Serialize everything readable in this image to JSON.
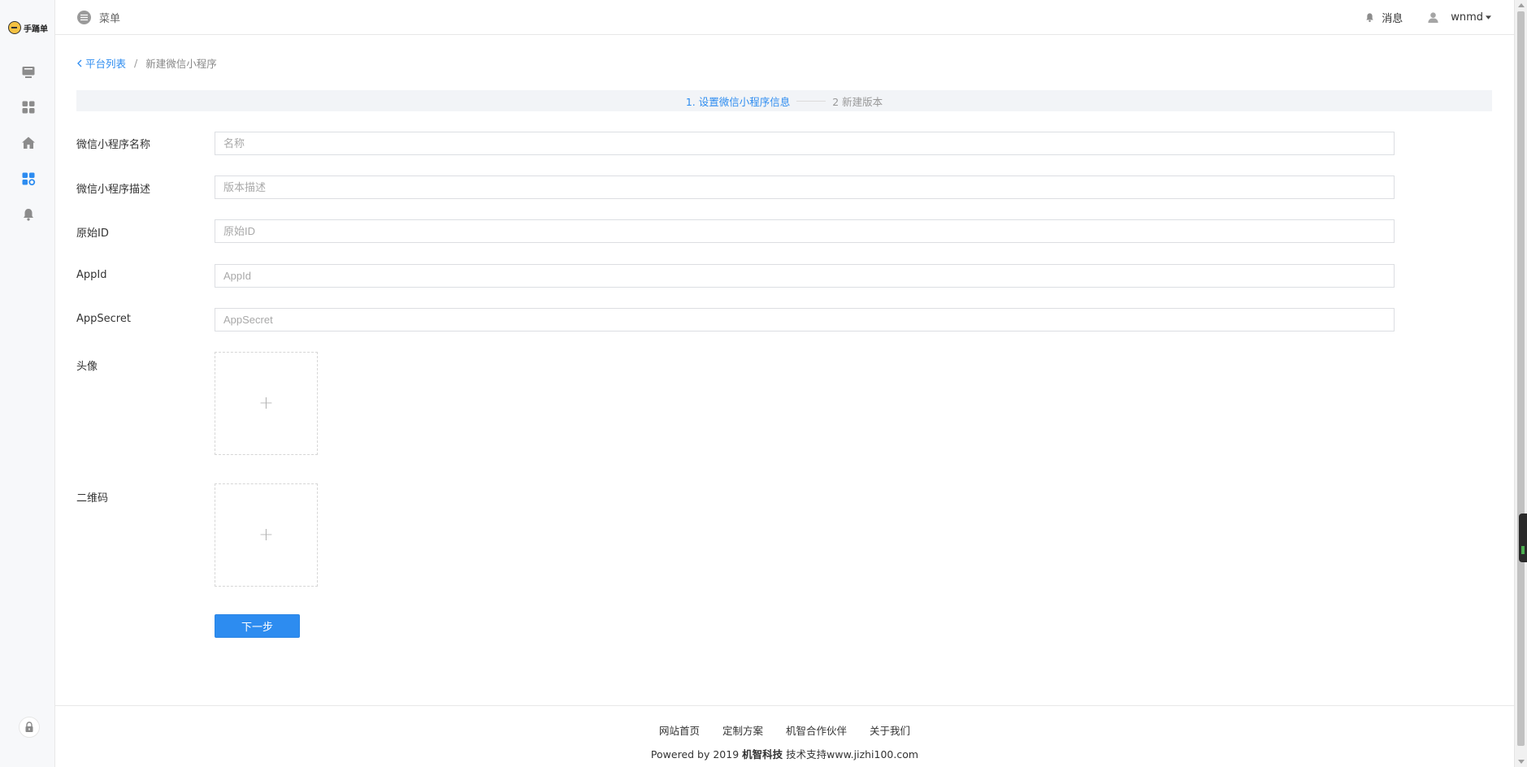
{
  "brand": {
    "logo_text": "手踊单"
  },
  "topbar": {
    "menu_label": "菜单",
    "messages_label": "消息",
    "username": "wnmd"
  },
  "breadcrumb": {
    "back_label": "平台列表",
    "separator": "/",
    "current": "新建微信小程序"
  },
  "steps": {
    "step1": "1. 设置微信小程序信息",
    "step2": "2 新建版本"
  },
  "form": {
    "name": {
      "label": "微信小程序名称",
      "placeholder": "名称",
      "value": ""
    },
    "description": {
      "label": "微信小程序描述",
      "placeholder": "版本描述",
      "value": ""
    },
    "original_id": {
      "label": "原始ID",
      "placeholder": "原始ID",
      "value": ""
    },
    "app_id": {
      "label": "AppId",
      "placeholder": "AppId",
      "value": ""
    },
    "app_secret": {
      "label": "AppSecret",
      "placeholder": "AppSecret",
      "value": ""
    },
    "avatar": {
      "label": "头像",
      "plus": "+"
    },
    "qrcode": {
      "label": "二维码",
      "plus": "+"
    },
    "next_button": "下一步"
  },
  "footer": {
    "links": [
      "网站首页",
      "定制方案",
      "机智合作伙伴",
      "关于我们"
    ],
    "copy_prefix": "Powered by 2019 ",
    "copy_company": "机智科技",
    "copy_suffix": " 技术支持www.jizhi100.com"
  },
  "colors": {
    "accent": "#2d8cf0",
    "sidebar_bg": "#f7f8fa",
    "steps_bg": "#f2f4f7"
  },
  "icons": {
    "sidebar": [
      "monitor-icon",
      "apps-icon",
      "home-icon",
      "app-settings-icon",
      "bell-icon"
    ],
    "sidebar_bottom": "lock-icon",
    "topbar": [
      "menu-icon",
      "bell-icon",
      "user-icon",
      "caret-down-icon"
    ]
  }
}
